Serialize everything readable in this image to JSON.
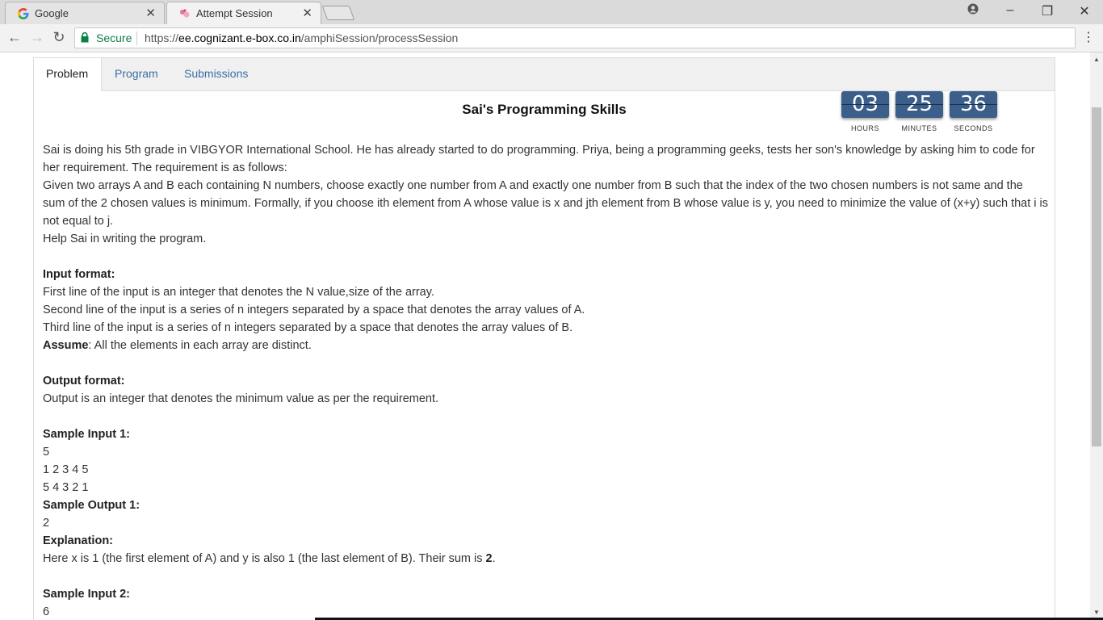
{
  "browser": {
    "tabs": [
      {
        "title": "Google",
        "icon": "google-g-icon"
      },
      {
        "title": "Attempt Session",
        "icon": "ebox-logo-icon"
      }
    ],
    "address": {
      "secure_label": "Secure",
      "url_scheme": "https://",
      "url_host": "ee.cognizant.e-box.co.in",
      "url_path": "/amphiSession/processSession"
    }
  },
  "page": {
    "tabs": [
      "Problem",
      "Program",
      "Submissions"
    ],
    "title": "Sai's Programming Skills",
    "timer": {
      "hours": "03",
      "minutes": "25",
      "seconds": "36",
      "hours_label": "HOURS",
      "minutes_label": "MINUTES",
      "seconds_label": "SECONDS"
    },
    "description": [
      "Sai is doing his 5th grade in VIBGYOR International School. He has already started to do programming. Priya, being a programming geeks, tests her son's knowledge by asking him to code for her requirement. The requirement is as follows:",
      "Given two arrays A and B each containing N numbers, choose exactly one number from A and exactly one number from B such that the index of the two chosen numbers is not same and the sum of the 2 chosen values is minimum. Formally, if you choose ith element from A whose value is x and jth element from B whose value is y, you need to minimize the value of (x+y) such that i is not equal to j.",
      "Help Sai in writing the program."
    ],
    "input_format": {
      "heading": "Input format:",
      "lines": [
        "First line of the input is an integer that denotes the N value,size of the array.",
        "Second line of the input is a series of n integers separated by a space that denotes the array values of A.",
        "Third line of the input is a series of n integers separated by a space that denotes the array values of B."
      ],
      "assume_label": "Assume",
      "assume_text": ": All the elements in each array are distinct."
    },
    "output_format": {
      "heading": "Output format:",
      "text": "Output is an integer that denotes the minimum value as per the requirement."
    },
    "sample1": {
      "input_heading": "Sample Input 1:",
      "input_lines": [
        "5",
        "1 2 3 4 5",
        "5 4 3 2 1"
      ],
      "output_heading": "Sample Output 1:",
      "output": "2",
      "explanation_heading": "Explanation:",
      "explanation_text": "Here x is 1 (the first element of A) and y is also 1 (the last element of B). Their sum is ",
      "explanation_bold": "2",
      "explanation_end": "."
    },
    "sample2": {
      "input_heading": "Sample Input 2:",
      "input_first": "6"
    }
  }
}
